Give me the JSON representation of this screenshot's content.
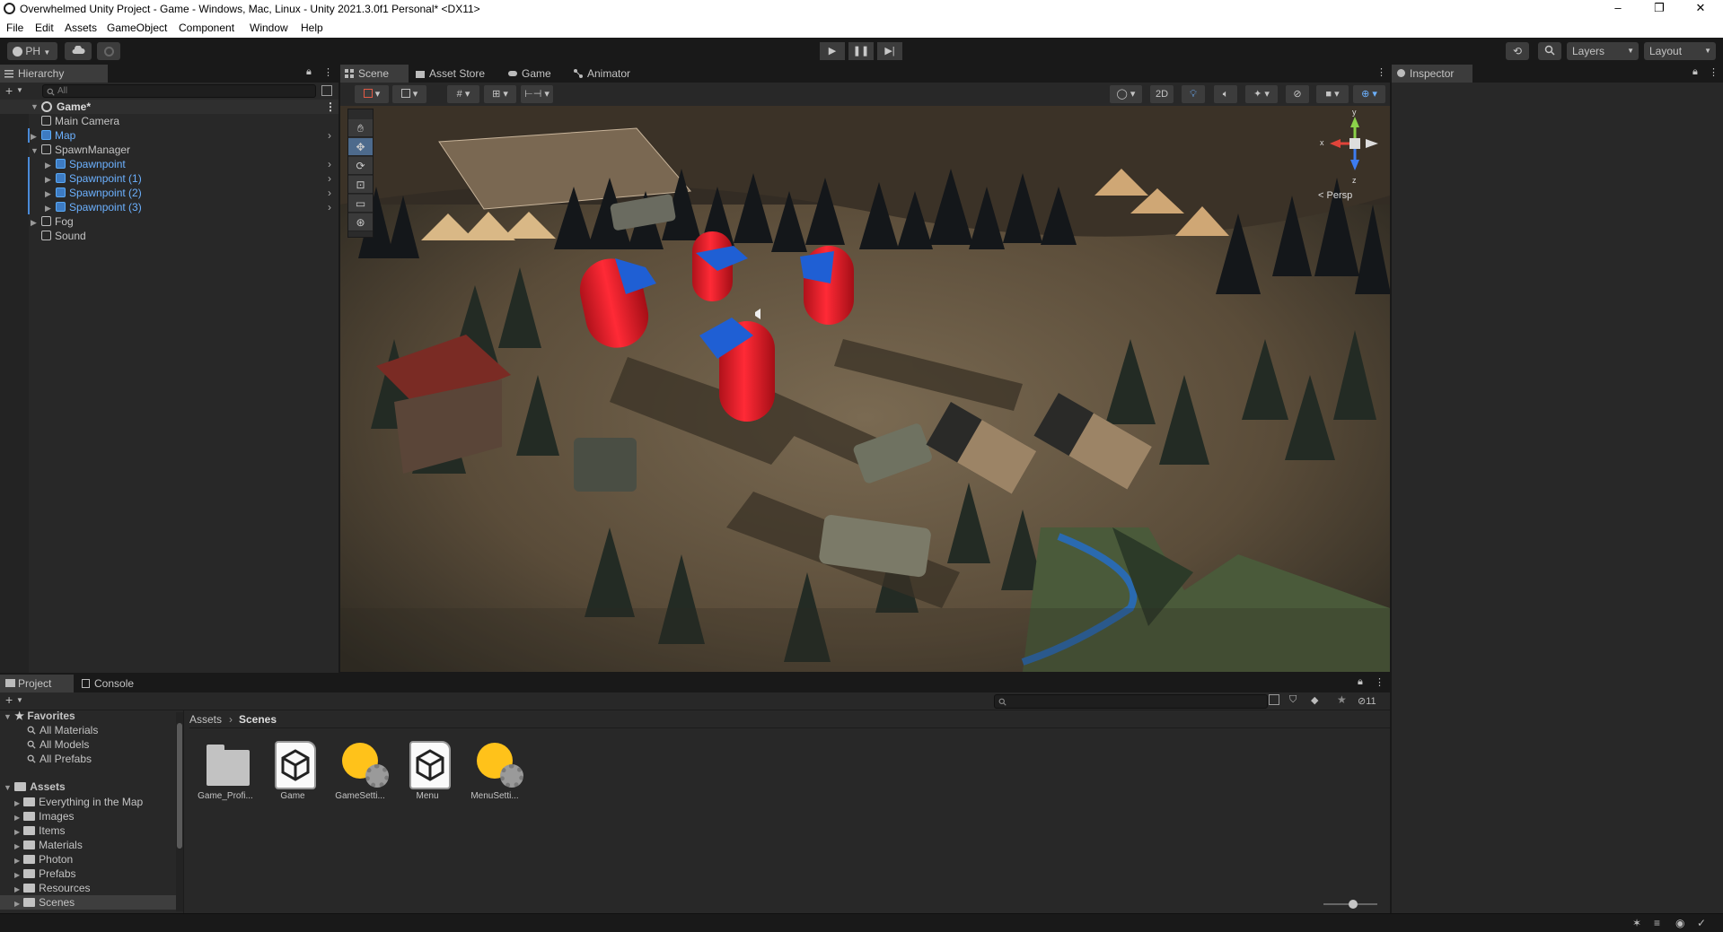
{
  "window": {
    "title": "Overwhelmed Unity Project - Game - Windows, Mac, Linux - Unity 2021.3.0f1 Personal* <DX11>",
    "minimize": "–",
    "maximize": "❐",
    "close": "✕"
  },
  "menu": [
    "File",
    "Edit",
    "Assets",
    "GameObject",
    "Component",
    "Window",
    "Help"
  ],
  "toolbar": {
    "account": "PH",
    "layers": "Layers",
    "layout": "Layout"
  },
  "hierarchy": {
    "tab": "Hierarchy",
    "search_placeholder": "All",
    "root": "Game*",
    "items": [
      {
        "label": "Main Camera",
        "indent": 1,
        "blue": false,
        "expand": "",
        "prefab": false
      },
      {
        "label": "Map",
        "indent": 1,
        "blue": true,
        "expand": "▶",
        "prefab": true
      },
      {
        "label": "SpawnManager",
        "indent": 1,
        "blue": false,
        "expand": "▼",
        "prefab": false
      },
      {
        "label": "Spawnpoint",
        "indent": 2,
        "blue": true,
        "expand": "▶",
        "prefab": true
      },
      {
        "label": "Spawnpoint (1)",
        "indent": 2,
        "blue": true,
        "expand": "▶",
        "prefab": true
      },
      {
        "label": "Spawnpoint (2)",
        "indent": 2,
        "blue": true,
        "expand": "▶",
        "prefab": true
      },
      {
        "label": "Spawnpoint (3)",
        "indent": 2,
        "blue": true,
        "expand": "▶",
        "prefab": true
      },
      {
        "label": "Fog",
        "indent": 1,
        "blue": false,
        "expand": "▶",
        "prefab": false
      },
      {
        "label": "Sound",
        "indent": 1,
        "blue": false,
        "expand": "",
        "prefab": false
      }
    ]
  },
  "center_tabs": {
    "scene": "Scene",
    "asset_store": "Asset Store",
    "game": "Game",
    "animator": "Animator"
  },
  "scene": {
    "mode_2d": "2D",
    "persp_label": "Persp",
    "gizmo_y": "y",
    "gizmo_x": "x",
    "gizmo_z": "z"
  },
  "inspector": {
    "tab": "Inspector"
  },
  "project": {
    "tab_project": "Project",
    "tab_console": "Console",
    "hidden_count": "11",
    "breadcrumb_root": "Assets",
    "breadcrumb_sep": "›",
    "breadcrumb_current": "Scenes",
    "favorites_label": "Favorites",
    "favorites": [
      "All Materials",
      "All Models",
      "All Prefabs"
    ],
    "assets_label": "Assets",
    "folders": [
      "Everything in the Map",
      "Images",
      "Items",
      "Materials",
      "Photon",
      "Prefabs",
      "Resources",
      "Scenes"
    ],
    "asset_items": [
      {
        "label": "Game_Profi...",
        "kind": "folder"
      },
      {
        "label": "Game",
        "kind": "scene"
      },
      {
        "label": "GameSetti...",
        "kind": "settings"
      },
      {
        "label": "Menu",
        "kind": "scene"
      },
      {
        "label": "MenuSetti...",
        "kind": "settings"
      }
    ]
  },
  "colors": {
    "bg_dark": "#191919",
    "panel": "#282828",
    "tab_active": "#3c3c3c",
    "prefab_blue": "#6cb1ff",
    "capsule_red": "#e5202b",
    "cube_blue": "#2060d0",
    "ground": "#5e513e"
  }
}
